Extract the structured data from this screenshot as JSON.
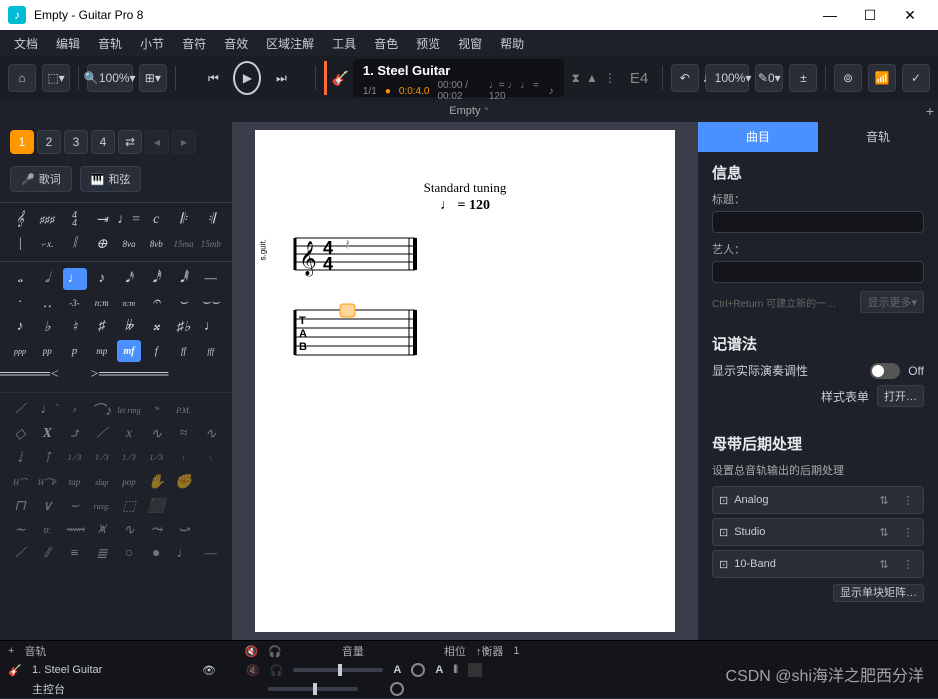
{
  "window": {
    "title": "Empty - Guitar Pro 8"
  },
  "menu": [
    "文档",
    "编辑",
    "音轨",
    "小节",
    "音符",
    "音效",
    "区域注解",
    "工具",
    "音色",
    "预览",
    "视窗",
    "帮助"
  ],
  "toolbar": {
    "zoom": "100%"
  },
  "track": {
    "name": "1. Steel Guitar",
    "bars": "1/1",
    "duration": "0:0:4.0",
    "time": "00:00 / 00:02",
    "tempo_text": "♩= ♩  ♩ = 120",
    "chord": "E4"
  },
  "righttoolbar": {
    "note_pct": "100%",
    "pencil": "0"
  },
  "doctab": {
    "name": "Empty"
  },
  "voices": [
    "1",
    "2",
    "3",
    "4"
  ],
  "left_buttons": {
    "lyrics": "歌词",
    "chords": "和弦"
  },
  "score": {
    "tuning": "Standard tuning",
    "tempo_label": "♩ = 120",
    "inst_label": "s.guit."
  },
  "right": {
    "tabs": [
      "曲目",
      "音轨"
    ],
    "info_h": "信息",
    "title_lbl": "标题：",
    "artist_lbl": "艺人：",
    "hint": "Ctrl+Return 可建立新的一…",
    "more": "显示更多",
    "notation_h": "记谱法",
    "show_perf": "显示实际演奏调性",
    "off": "Off",
    "stylesheet": "样式表单",
    "open": "打开…",
    "master_h": "母带后期处理",
    "master_sub": "设置总音轨输出的后期处理",
    "fx": [
      "Analog",
      "Studio",
      "10-Band"
    ],
    "matrix": "显示单块矩阵…"
  },
  "bottom": {
    "cols": {
      "track": "音轨",
      "vol": "音量",
      "pan": "相位",
      "eq": "↑衡器"
    },
    "tracks": [
      {
        "num": "1.",
        "name": "Steel Guitar"
      },
      {
        "num": "",
        "name": "主控台"
      }
    ],
    "auto": "A",
    "eq_num": "1"
  },
  "watermark": "CSDN @shi海洋之肥西分洋"
}
